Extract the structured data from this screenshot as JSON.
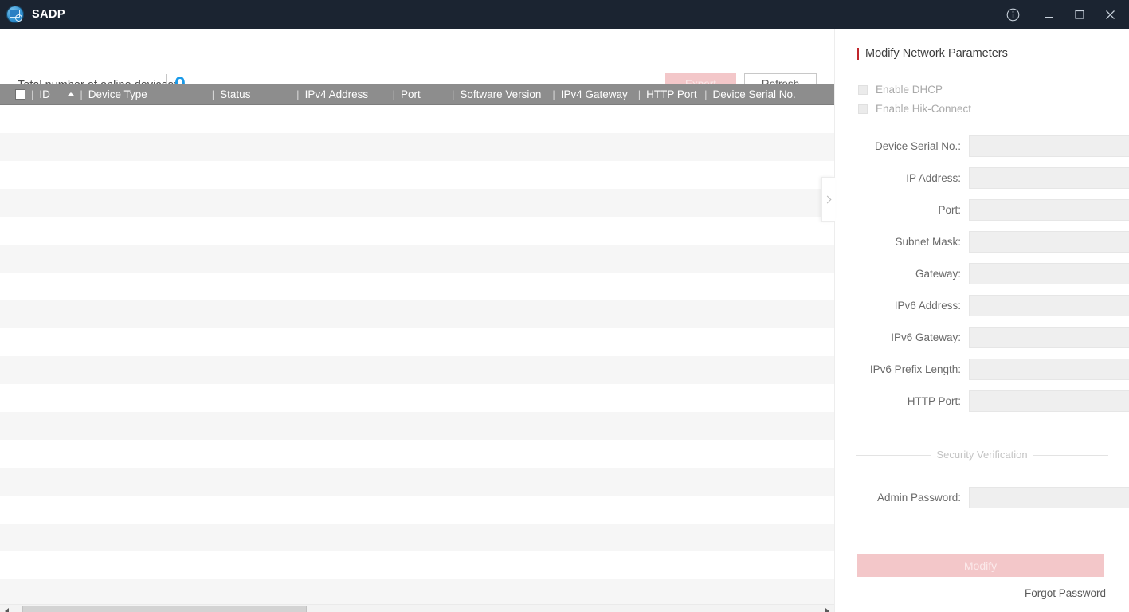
{
  "titlebar": {
    "app_name": "SADP",
    "logo_icon": "sadp-search-device-icon",
    "controls": [
      {
        "name": "info-icon",
        "label": "Info"
      },
      {
        "name": "minimize-icon",
        "label": "Minimize"
      },
      {
        "name": "maximize-icon",
        "label": "Maximize"
      },
      {
        "name": "close-icon",
        "label": "Close"
      }
    ],
    "background": "#1b2431"
  },
  "toolbar": {
    "count_label": "Total number of online devices:",
    "count_value": "0",
    "count_value_color": "#1a9ae8",
    "export_label": "Export",
    "refresh_label": "Refresh",
    "export_disabled_color": "#f3c7c9"
  },
  "table": {
    "header_background": "#8d8d8d",
    "select_all_checkbox": "unchecked",
    "sort_column": "ID",
    "sort_direction": "ascending",
    "columns": [
      {
        "label": "ID"
      },
      {
        "label": "Device Type"
      },
      {
        "label": "Status"
      },
      {
        "label": "IPv4 Address"
      },
      {
        "label": "Port"
      },
      {
        "label": "Software Version"
      },
      {
        "label": "IPv4 Gateway"
      },
      {
        "label": "HTTP Port"
      },
      {
        "label": "Device Serial No."
      }
    ],
    "rows": [],
    "empty": true,
    "stripe_odd": "#ffffff",
    "stripe_even": "#f6f6f6"
  },
  "scrollbar": {
    "left_arrow_icon": "triangle-left-icon",
    "right_arrow_icon": "triangle-right-icon",
    "thumb_position_percent": 0
  },
  "collapse_handle": {
    "icon": "chevron-right-icon"
  },
  "panel": {
    "title": "Modify Network Parameters",
    "accent_color": "#c0262c",
    "checkboxes": [
      {
        "label": "Enable DHCP",
        "checked": false
      },
      {
        "label": "Enable Hik-Connect",
        "checked": false
      }
    ],
    "fields": [
      {
        "label": "Device Serial No.:",
        "value": "",
        "placeholder": "",
        "name": "device-serial-no-field"
      },
      {
        "label": "IP Address:",
        "value": "",
        "placeholder": "",
        "name": "ip-address-field"
      },
      {
        "label": "Port:",
        "value": "",
        "placeholder": "",
        "name": "port-field"
      },
      {
        "label": "Subnet Mask:",
        "value": "",
        "placeholder": "",
        "name": "subnet-mask-field"
      },
      {
        "label": "Gateway:",
        "value": "",
        "placeholder": "",
        "name": "gateway-field"
      },
      {
        "label": "IPv6 Address:",
        "value": "",
        "placeholder": "",
        "name": "ipv6-address-field"
      },
      {
        "label": "IPv6 Gateway:",
        "value": "",
        "placeholder": "",
        "name": "ipv6-gateway-field"
      },
      {
        "label": "IPv6 Prefix Length:",
        "value": "",
        "placeholder": "",
        "name": "ipv6-prefix-length-field"
      },
      {
        "label": "HTTP Port:",
        "value": "",
        "placeholder": "",
        "name": "http-port-field"
      }
    ],
    "security_section_label": "Security Verification",
    "admin_password": {
      "label": "Admin Password:",
      "value": "",
      "placeholder": ""
    },
    "modify_label": "Modify",
    "modify_disabled_color": "#f3c7c9",
    "forgot_password_label": "Forgot Password"
  }
}
